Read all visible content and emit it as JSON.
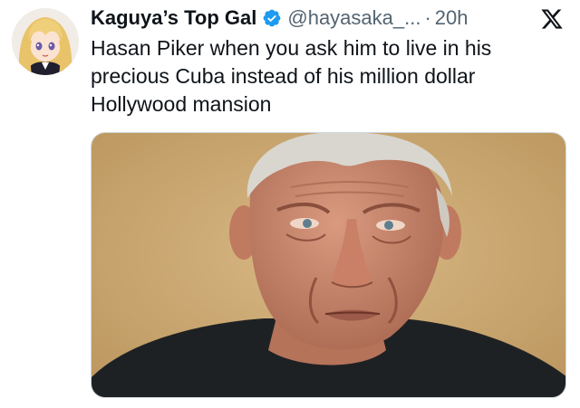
{
  "tweet": {
    "display_name": "Kaguya’s Top Gal",
    "handle": "@hayasaka_...",
    "separator": "·",
    "time": "20h",
    "text": "Hasan Piker when you ask him to live in his precious Cuba instead of his million dollar Hollywood mansion"
  },
  "icons": {
    "avatar": "anime-avatar-icon",
    "verified": "verified-badge-icon",
    "brand": "x-logo-icon",
    "media": "photo-older-man-portrait"
  },
  "colors": {
    "verified_blue": "#1d9bf0",
    "secondary_text": "#536471",
    "primary_text": "#0f1419"
  }
}
